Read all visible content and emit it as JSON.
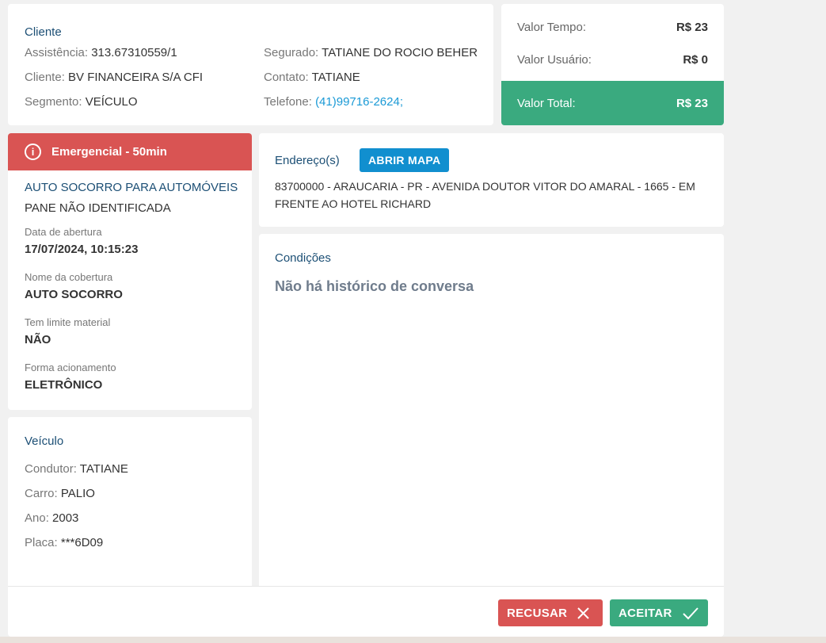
{
  "cliente": {
    "title": "Cliente",
    "assistencia_label": "Assistência:",
    "assistencia_value": "313.67310559/1",
    "cliente_label": "Cliente:",
    "cliente_value": "BV FINANCEIRA S/A CFI",
    "segmento_label": "Segmento:",
    "segmento_value": "VEÍCULO",
    "segurado_label": "Segurado:",
    "segurado_value": "TATIANE DO ROCIO BEHER",
    "contato_label": "Contato:",
    "contato_value": "TATIANE",
    "telefone_label": "Telefone:",
    "telefone_value": "(41)99716-2624;"
  },
  "valores": {
    "tempo_label": "Valor Tempo:",
    "tempo_value": "R$ 23",
    "usuario_label": "Valor Usuário:",
    "usuario_value": "R$ 0",
    "total_label": "Valor Total:",
    "total_value": "R$ 23",
    "total_color": "#3aaa7f"
  },
  "servico": {
    "alert_icon": "info-circle-icon",
    "alert_text": "Emergencial - 50min",
    "alert_color": "#d95453",
    "title": "AUTO SOCORRO PARA AUTOMÓVEIS",
    "subtitle": "PANE NÃO IDENTIFICADA",
    "fields": [
      {
        "label": "Data de abertura",
        "value": "17/07/2024, 10:15:23"
      },
      {
        "label": "Nome da cobertura",
        "value": "AUTO SOCORRO"
      },
      {
        "label": "Tem limite material",
        "value": "NÃO"
      },
      {
        "label": "Forma acionamento",
        "value": "ELETRÔNICO"
      }
    ]
  },
  "veiculo": {
    "title": "Veículo",
    "condutor_label": "Condutor:",
    "condutor_value": "TATIANE",
    "carro_label": "Carro:",
    "carro_value": "PALIO",
    "ano_label": "Ano:",
    "ano_value": "2003",
    "placa_label": "Placa:",
    "placa_value": "***6D09"
  },
  "endereco": {
    "title": "Endereço(s)",
    "map_button": "ABRIR MAPA",
    "text": "83700000 - ARAUCARIA - PR - AVENIDA DOUTOR VITOR DO AMARAL - 1665 - EM FRENTE AO HOTEL RICHARD"
  },
  "condicoes": {
    "title": "Condições",
    "empty_text": "Não há histórico de conversa"
  },
  "actions": {
    "recusar_label": "RECUSAR",
    "recusar_icon": "close-icon",
    "aceitar_label": "ACEITAR",
    "aceitar_icon": "check-icon"
  }
}
